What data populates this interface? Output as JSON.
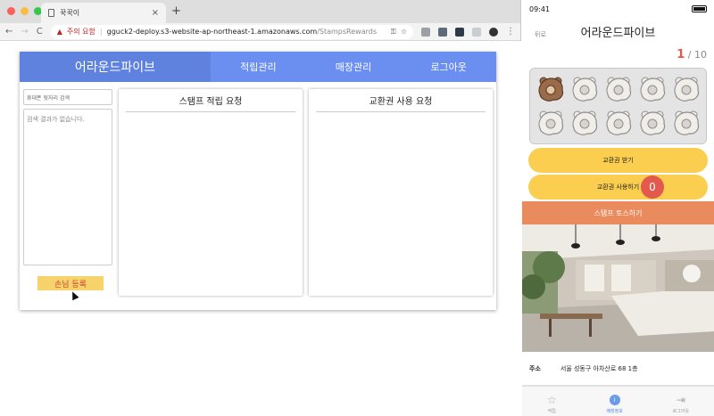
{
  "browser": {
    "tab_title": "꾹꾹이",
    "toolbar": {
      "security_warning": "주의 요함",
      "url_host": "gguck2-deploy.s3-website-ap-northeast-1.amazonaws.com",
      "url_path": "/StampsRewards"
    }
  },
  "web_app": {
    "brand": "어라운드파이브",
    "nav": [
      "적립관리",
      "매장관리",
      "로그아웃"
    ],
    "search_placeholder": "휴대폰 뒷자리 검색",
    "no_results": "검색 결과가 없습니다.",
    "register_button": "손님 등록",
    "panel_stamp_requests": "스탬프 적립 요청",
    "panel_coupon_requests": "교환권 사용 요청"
  },
  "phone": {
    "time": "09:41",
    "back_label": "뒤로",
    "title": "어라운드파이브",
    "stamp_count": "1",
    "stamp_total": "/ 10",
    "stamps_filled": 1,
    "stamps_slots": 10,
    "receive_coupon_button": "교환권 받기",
    "use_coupon_button": "교환권 사용하기",
    "coupon_badge": "0",
    "toss_button": "스탬프 토스하기",
    "address_label": "주소",
    "address_value": "서울 성동구 아차산로 68 1층",
    "tabs": [
      "적립",
      "매장정보",
      "로그아웃"
    ],
    "colors": {
      "accent_yellow": "#fbce4f",
      "accent_orange": "#ea8b5e",
      "badge_red": "#e4594e",
      "nav_blue": "#6a8ff0"
    }
  }
}
